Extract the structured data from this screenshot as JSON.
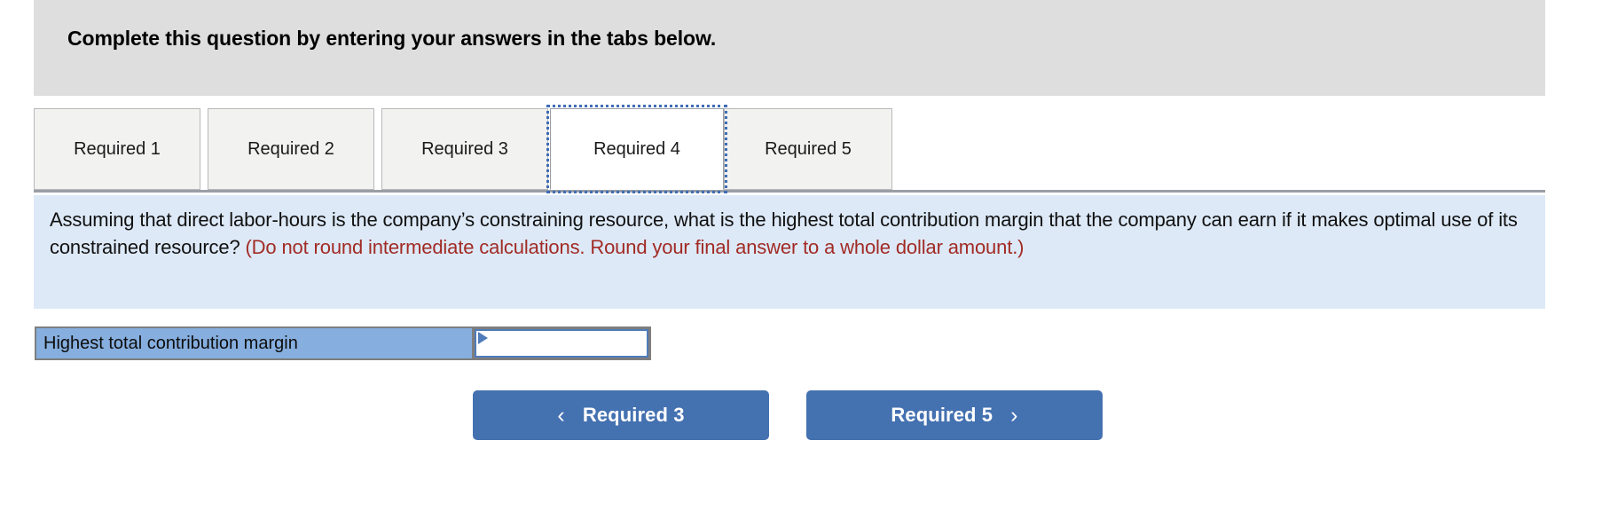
{
  "header": {
    "title": "Complete this question by entering your answers in the tabs below."
  },
  "tabs": {
    "items": [
      {
        "label": "Required 1",
        "active": false
      },
      {
        "label": "Required 2",
        "active": false
      },
      {
        "label": "Required 3",
        "active": false
      },
      {
        "label": "Required 4",
        "active": true
      },
      {
        "label": "Required 5",
        "active": false
      }
    ]
  },
  "question": {
    "main_text": "Assuming that direct labor-hours is the company’s constraining resource, what is the highest total contribution margin that the company can earn if it makes optimal use of its constrained resource? ",
    "hint_text": "(Do not round intermediate calculations. Round your final answer to a whole dollar amount.)"
  },
  "answer": {
    "label": "Highest total contribution margin",
    "value": "",
    "placeholder": ""
  },
  "navigation": {
    "prev_label": "Required 3",
    "next_label": "Required 5",
    "prev_icon": "chevron-left-icon",
    "next_icon": "chevron-right-icon",
    "prev_glyph": "‹",
    "next_glyph": "›"
  },
  "colors": {
    "header_band": "#dedede",
    "question_panel": "#dde9f7",
    "answer_label": "#86aede",
    "button": "#4471b0",
    "hint_text": "#a22b25",
    "focus_outline": "#3f6db5",
    "tab_inactive": "#f2f2f1",
    "tab_active": "#ffffff"
  }
}
